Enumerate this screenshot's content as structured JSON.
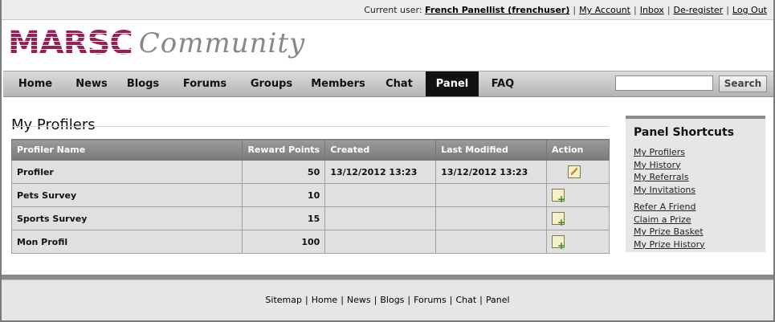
{
  "topbar": {
    "current_user_label": "Current user:",
    "user_name": "French Panellist (frenchuser)",
    "links": [
      "My Account",
      "Inbox",
      "De-register",
      "Log Out"
    ]
  },
  "logo": {
    "brand": "MARSC",
    "subtitle": "Community"
  },
  "nav": {
    "items": [
      "Home",
      "News",
      "Blogs",
      "Forums",
      "Groups",
      "Members",
      "Chat",
      "Panel",
      "FAQ"
    ],
    "active": "Panel",
    "search": {
      "placeholder": "",
      "value": "",
      "button_label": "Search"
    }
  },
  "main": {
    "title": "My Profilers",
    "table": {
      "headers": [
        "Profiler Name",
        "Reward Points",
        "Created",
        "Last Modified",
        "Action"
      ],
      "rows": [
        {
          "name": "Profiler",
          "points": "50",
          "created": "13/12/2012 13:23",
          "modified": "13/12/2012 13:23",
          "action_icon": "edit-icon"
        },
        {
          "name": "Pets Survey",
          "points": "10",
          "created": "",
          "modified": "",
          "action_icon": "add-icon"
        },
        {
          "name": "Sports Survey",
          "points": "15",
          "created": "",
          "modified": "",
          "action_icon": "add-icon"
        },
        {
          "name": "Mon Profil",
          "points": "100",
          "created": "",
          "modified": "",
          "action_icon": "add-icon"
        }
      ]
    }
  },
  "shortcuts": {
    "title": "Panel Shortcuts",
    "group1": [
      "My Profilers",
      "My History",
      "My Referrals",
      "My Invitations"
    ],
    "group2": [
      "Refer A Friend",
      "Claim a Prize",
      "My Prize Basket",
      "My Prize History"
    ]
  },
  "footer": {
    "links": [
      "Sitemap",
      "Home",
      "News",
      "Blogs",
      "Forums",
      "Chat",
      "Panel"
    ]
  },
  "colors": {
    "brand": "#9c1c56",
    "nav_active_bg": "#111111",
    "table_header": "#8a8a8a"
  }
}
